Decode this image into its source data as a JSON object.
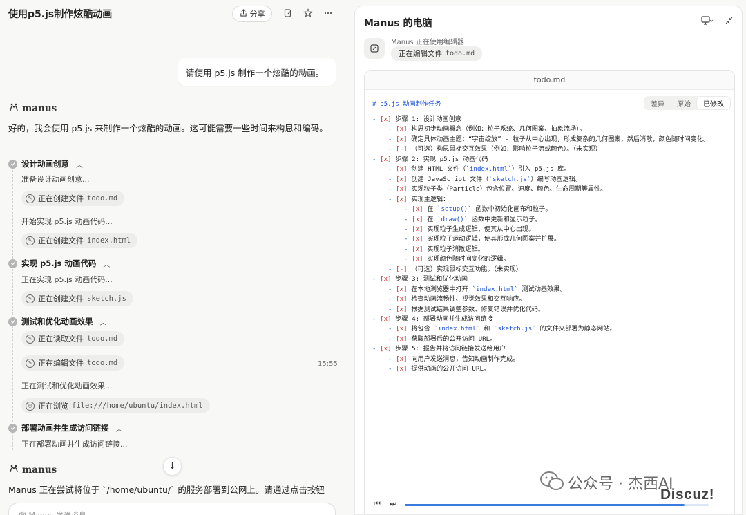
{
  "chat": {
    "title": "使用p5.js制作炫酷动画",
    "share_label": "分享",
    "user_message": "请使用 p5.js 制作一个炫酷的动画。",
    "agent_name": "manus",
    "intro": "好的，我会使用 p5.js 来制作一个炫酷的动画。这可能需要一些时间来构思和编码。",
    "steps": [
      {
        "label": "设计动画创意"
      },
      {
        "label": "实现 p5.js 动画代码"
      },
      {
        "label": "测试和优化动画效果"
      },
      {
        "label": "部署动画并生成访问链接"
      }
    ],
    "step1": {
      "text1": "准备设计动画创意...",
      "chip1": {
        "action": "正在创建文件",
        "path": "todo.md"
      },
      "text2": "开始实现 p5.js 动画代码...",
      "chip2": {
        "action": "正在创建文件",
        "path": "index.html"
      }
    },
    "step2": {
      "text1": "正在实现 p5.js 动画代码...",
      "chip1": {
        "action": "正在创建文件",
        "path": "sketch.js"
      }
    },
    "step3": {
      "chip1": {
        "action": "正在读取文件",
        "path": "todo.md"
      },
      "chip2": {
        "action": "正在编辑文件",
        "path": "todo.md"
      },
      "text1": "正在测试和优化动画效果...",
      "chip3": {
        "action": "正在浏览",
        "path": "file:///home/ubuntu/index.html"
      }
    },
    "step4": {
      "text1": "正在部署动画并生成访问链接..."
    },
    "timestamp": "15:55",
    "final_message": "Manus 正在尝试将位于 `/home/ubuntu/` 的服务部署到公网上。请通过点击按钮",
    "input_placeholder": "向 Manus 发送消息"
  },
  "computer": {
    "title": "Manus 的电脑",
    "status": "Manus 正在使用编辑器",
    "chip_action": "正在编辑文件",
    "chip_path": "todo.md",
    "file_name": "todo.md",
    "view_tabs": [
      "差异",
      "原始",
      "已修改"
    ],
    "active_view": "已修改",
    "progress": 0.92
  },
  "todo": {
    "heading": "# p5.js 动画制作任务",
    "lines": [
      {
        "indent": 0,
        "box": "[x]",
        "text": "步骤 1: 设计动画创意"
      },
      {
        "indent": 1,
        "box": "[x]",
        "text": "构思初步动画概念（例如：粒子系统、几何图案、抽象流场）。"
      },
      {
        "indent": 1,
        "box": "[x]",
        "text": "确定具体动画主题：“宇宙绽放” - 粒子从中心出现，形成复杂的几何图案，然后消散，颜色随时间变化。"
      },
      {
        "indent": 1,
        "box": "[-]",
        "text": "（可选）构思鼠标交互效果（例如：影响粒子流或颜色）。（未实现）"
      },
      {
        "indent": 0,
        "box": "[x]",
        "text": "步骤 2: 实现 p5.js 动画代码"
      },
      {
        "indent": 1,
        "box": "[x]",
        "text": "创建 HTML 文件（`index.html`）引入 p5.js 库。"
      },
      {
        "indent": 1,
        "box": "[x]",
        "text": "创建 JavaScript 文件（`sketch.js`）编写动画逻辑。"
      },
      {
        "indent": 1,
        "box": "[x]",
        "text": "实现粒子类（Particle）包含位置、速度、颜色、生命周期等属性。"
      },
      {
        "indent": 1,
        "box": "[x]",
        "text": "实现主逻辑："
      },
      {
        "indent": 2,
        "box": "[x]",
        "text": "在 `setup()` 函数中初始化画布和粒子。"
      },
      {
        "indent": 2,
        "box": "[x]",
        "text": "在 `draw()` 函数中更新和显示粒子。"
      },
      {
        "indent": 2,
        "box": "[x]",
        "text": "实现粒子生成逻辑，使其从中心出现。"
      },
      {
        "indent": 2,
        "box": "[x]",
        "text": "实现粒子运动逻辑，使其形成几何图案并扩展。"
      },
      {
        "indent": 2,
        "box": "[x]",
        "text": "实现粒子消散逻辑。"
      },
      {
        "indent": 2,
        "box": "[x]",
        "text": "实现颜色随时间变化的逻辑。"
      },
      {
        "indent": 1,
        "box": "[-]",
        "text": "（可选）实现鼠标交互功能。（未实现）"
      },
      {
        "indent": 0,
        "box": "[x]",
        "text": "步骤 3: 测试和优化动画"
      },
      {
        "indent": 1,
        "box": "[x]",
        "text": "在本地浏览器中打开 `index.html` 测试动画效果。"
      },
      {
        "indent": 1,
        "box": "[x]",
        "text": "检查动画流畅性、视觉效果和交互响应。"
      },
      {
        "indent": 1,
        "box": "[x]",
        "text": "根据测试结果调整参数、修复错误并优化代码。"
      },
      {
        "indent": 0,
        "box": "[x]",
        "text": "步骤 4: 部署动画并生成访问链接"
      },
      {
        "indent": 1,
        "box": "[x]",
        "text": "将包含 `index.html` 和 `sketch.js` 的文件夹部署为静态网站。"
      },
      {
        "indent": 1,
        "box": "[x]",
        "text": "获取部署后的公开访问 URL。"
      },
      {
        "indent": 0,
        "box": "[x]",
        "text": "步骤 5: 报告并将访问链接发送给用户"
      },
      {
        "indent": 1,
        "box": "[x]",
        "text": "向用户发送消息，告知动画制作完成。"
      },
      {
        "indent": 1,
        "box": "[x]",
        "text": "提供动画的公开访问 URL。"
      }
    ]
  },
  "watermark": {
    "text": "公众号 · 杰西AI",
    "site": "Discuz!"
  },
  "icons": {
    "share": "share-icon",
    "edit": "pencil-icon",
    "star": "star-icon",
    "more": "more-icon",
    "computer": "monitor-icon",
    "collapse": "collapse-icon",
    "globe": "globe-icon"
  }
}
